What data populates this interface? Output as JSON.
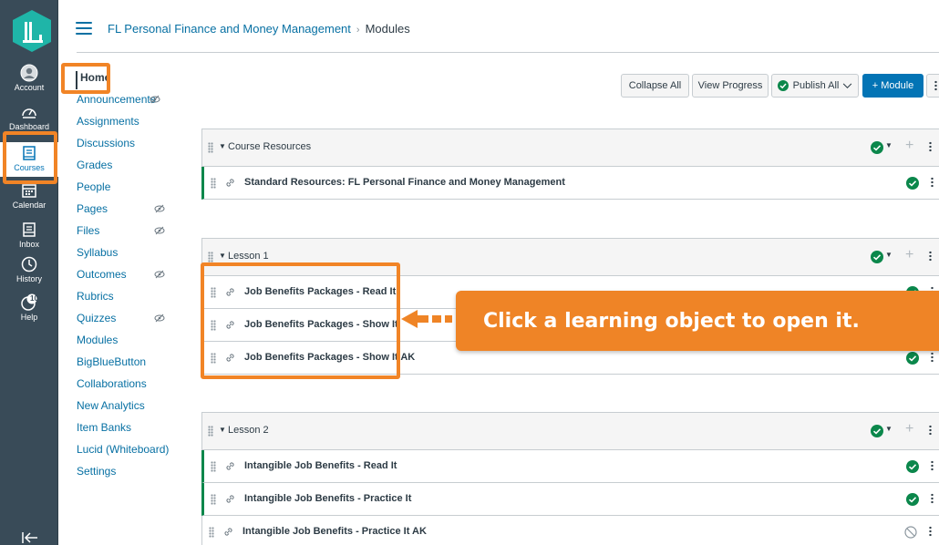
{
  "global_nav": {
    "items": [
      {
        "label": "Account",
        "icon": "account-icon"
      },
      {
        "label": "Dashboard",
        "icon": "dashboard-icon"
      },
      {
        "label": "Courses",
        "icon": "courses-icon",
        "active": true
      },
      {
        "label": "Calendar",
        "icon": "calendar-icon"
      },
      {
        "label": "Inbox",
        "icon": "inbox-icon"
      },
      {
        "label": "History",
        "icon": "history-icon"
      },
      {
        "label": "Help",
        "icon": "help-icon",
        "badge": "10"
      }
    ]
  },
  "breadcrumb": {
    "course": "FL Personal Finance and Money Management",
    "separator": "›",
    "current": "Modules"
  },
  "course_nav": {
    "items": [
      {
        "label": "Home",
        "active": true
      },
      {
        "label": "Announcements",
        "hidden": true
      },
      {
        "label": "Assignments"
      },
      {
        "label": "Discussions"
      },
      {
        "label": "Grades"
      },
      {
        "label": "People"
      },
      {
        "label": "Pages",
        "hidden": true
      },
      {
        "label": "Files",
        "hidden": true
      },
      {
        "label": "Syllabus"
      },
      {
        "label": "Outcomes",
        "hidden": true
      },
      {
        "label": "Rubrics"
      },
      {
        "label": "Quizzes",
        "hidden": true
      },
      {
        "label": "Modules"
      },
      {
        "label": "BigBlueButton"
      },
      {
        "label": "Collaborations"
      },
      {
        "label": "New Analytics"
      },
      {
        "label": "Item Banks"
      },
      {
        "label": "Lucid (Whiteboard)"
      },
      {
        "label": "Settings"
      }
    ]
  },
  "toolbar": {
    "collapse_all": "Collapse All",
    "view_progress": "View Progress",
    "publish_all": "Publish All",
    "add_module": "+ Module"
  },
  "modules": [
    {
      "title": "Course Resources",
      "items": [
        {
          "title": "Standard Resources: FL Personal Finance and Money Management",
          "status": "published"
        }
      ]
    },
    {
      "title": "Lesson 1",
      "items": [
        {
          "title": "Job Benefits Packages - Read It",
          "status": "published"
        },
        {
          "title": "Job Benefits Packages - Show It",
          "status": "published"
        },
        {
          "title": "Job Benefits Packages - Show It AK",
          "status": "published"
        }
      ]
    },
    {
      "title": "Lesson 2",
      "items": [
        {
          "title": "Intangible Job Benefits - Read It",
          "status": "published"
        },
        {
          "title": "Intangible Job Benefits - Practice It",
          "status": "published"
        },
        {
          "title": "Intangible Job Benefits - Practice It AK",
          "status": "unpublished"
        }
      ]
    }
  ],
  "callout": {
    "text": "Click a learning object to open it."
  },
  "colors": {
    "nav_bg": "#394b58",
    "link": "#0770a3",
    "published_green": "#0b874b",
    "highlight_orange": "#f18426",
    "primary_button": "#0374b5"
  }
}
